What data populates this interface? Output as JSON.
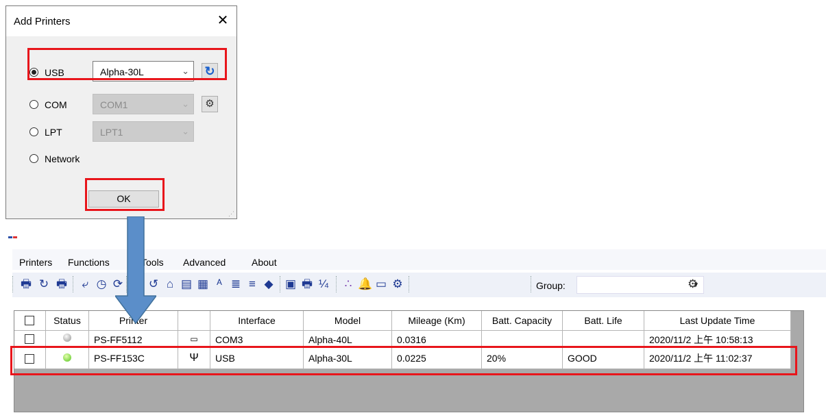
{
  "dialog": {
    "title": "Add Printers",
    "close_glyph": "✕",
    "options": [
      {
        "label": "USB",
        "selected": true,
        "combo_value": "Alpha-30L",
        "combo_enabled": true
      },
      {
        "label": "COM",
        "selected": false,
        "combo_value": "COM1",
        "combo_enabled": false
      },
      {
        "label": "LPT",
        "selected": false,
        "combo_value": "LPT1",
        "combo_enabled": false
      },
      {
        "label": "Network",
        "selected": false
      }
    ],
    "refresh_icon": "↻",
    "settings_icon": "gear-icon",
    "ok_label": "OK"
  },
  "menu": [
    "Printers",
    "Functions",
    "Tools",
    "Advanced",
    "About"
  ],
  "toolbar": {
    "icons": [
      "add-printer-icon",
      "refresh-icon",
      "remove-printer-icon",
      "import-icon",
      "clock-icon",
      "feed-icon",
      "calibrate-icon",
      "undo-icon",
      "home-icon",
      "form-icon",
      "edit-form-icon",
      "font-size-icon",
      "align-left-icon",
      "align-right-icon",
      "tag-icon",
      "terminal-icon",
      "print-icon",
      "fraction-icon",
      "dots-icon",
      "bell-icon",
      "ab-icon",
      "settings-panel-icon"
    ],
    "group_label": "Group:",
    "group_value": ""
  },
  "table": {
    "columns": [
      "",
      "Status",
      "Printer",
      "",
      "Interface",
      "Model",
      "Mileage (Km)",
      "Batt. Capacity",
      "Batt. Life",
      "Last Update Time"
    ],
    "rows": [
      {
        "checked": false,
        "status": "gray",
        "printer": "PS-FF5112",
        "iface_icon": "com-port-icon",
        "interface": "COM3",
        "model": "Alpha-40L",
        "mileage": "0.0316",
        "batt_capacity": "",
        "batt_life": "",
        "last_update": "2020/11/2 上午 10:58:13"
      },
      {
        "checked": false,
        "status": "green",
        "printer": "PS-FF153C",
        "iface_icon": "usb-icon",
        "interface": "USB",
        "model": "Alpha-30L",
        "mileage": "0.0225",
        "batt_capacity": "20%",
        "batt_life": "GOOD",
        "last_update": "2020/11/2 上午 11:02:37"
      }
    ]
  },
  "colors": {
    "highlight": "#e8151b",
    "arrow": "#5b8ec9"
  }
}
